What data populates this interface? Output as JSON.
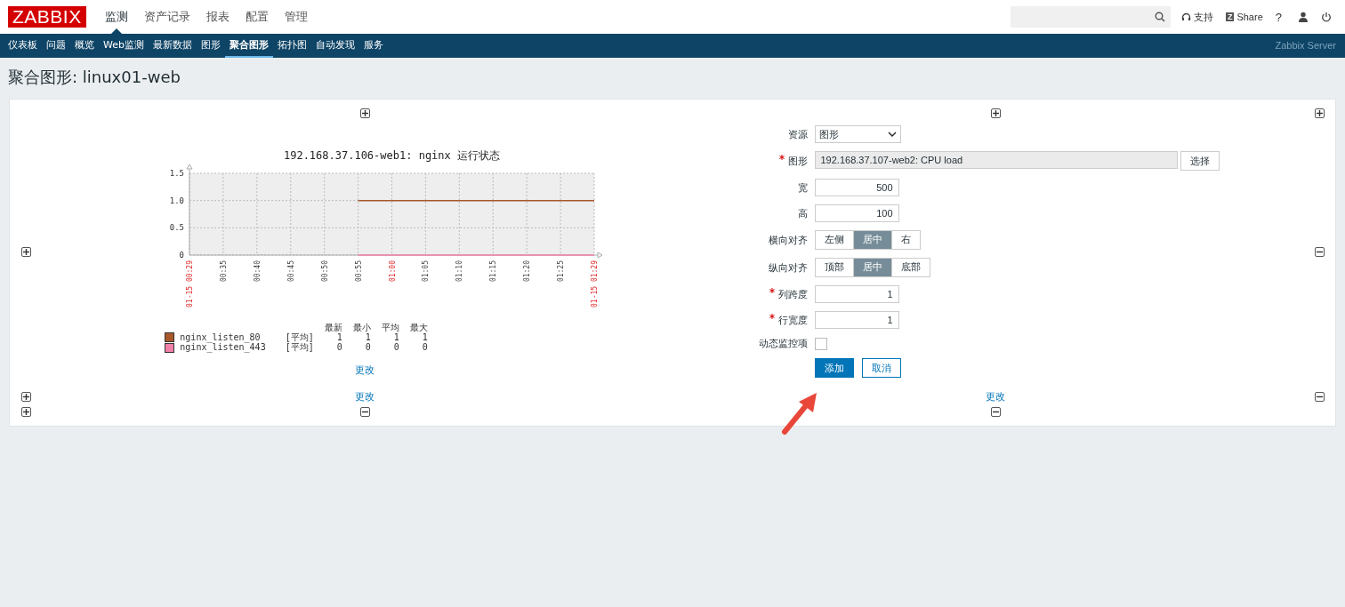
{
  "header": {
    "logo": "ZABBIX",
    "menu": [
      {
        "label": "监测",
        "selected": true
      },
      {
        "label": "资产记录",
        "selected": false
      },
      {
        "label": "报表",
        "selected": false
      },
      {
        "label": "配置",
        "selected": false
      },
      {
        "label": "管理",
        "selected": false
      }
    ],
    "support": "支持",
    "share_badge": "Z",
    "share": "Share",
    "help": "?"
  },
  "subnav": {
    "items": [
      {
        "label": "仪表板",
        "selected": false
      },
      {
        "label": "问题",
        "selected": false
      },
      {
        "label": "概览",
        "selected": false
      },
      {
        "label": "Web监测",
        "selected": false
      },
      {
        "label": "最新数据",
        "selected": false
      },
      {
        "label": "图形",
        "selected": false
      },
      {
        "label": "聚合图形",
        "selected": true
      },
      {
        "label": "拓扑图",
        "selected": false
      },
      {
        "label": "自动发现",
        "selected": false
      },
      {
        "label": "服务",
        "selected": false
      }
    ],
    "server": "Zabbix Server"
  },
  "page_title": "聚合图形: linux01-web",
  "graph": {
    "chart_data": {
      "type": "line",
      "title": "192.168.37.106-web1: nginx 运行状态",
      "categories": [
        "01-15 00:29",
        "00:35",
        "00:40",
        "00:45",
        "00:50",
        "00:55",
        "01:00",
        "01:05",
        "01:10",
        "01:15",
        "01:20",
        "01:25",
        "01-15 01:29"
      ],
      "series": [
        {
          "name": "nginx_listen_80",
          "color": "#a8582a",
          "values": [
            null,
            null,
            null,
            null,
            null,
            1,
            1,
            1,
            1,
            1,
            1,
            1,
            1
          ]
        },
        {
          "name": "nginx_listen_443",
          "color": "#f080a8",
          "values": [
            null,
            null,
            null,
            null,
            null,
            0,
            0,
            0,
            0,
            0,
            0,
            0,
            0
          ]
        }
      ],
      "ylim": [
        0,
        1.5
      ],
      "grid": true,
      "yticks": [
        {
          "value": 0,
          "label": "0"
        },
        {
          "value": 0.5,
          "label": "0.5"
        },
        {
          "value": 1,
          "label": "1.0"
        },
        {
          "value": 1.5,
          "label": "1.5"
        }
      ]
    },
    "x_label_highlighted": [
      true,
      false,
      false,
      false,
      false,
      false,
      true,
      false,
      false,
      false,
      false,
      false,
      true
    ],
    "legend": {
      "columns": [
        "最新",
        "最小",
        "平均",
        "最大"
      ],
      "rows": [
        {
          "func": "[平均]",
          "values": [
            "1",
            "1",
            "1",
            "1"
          ]
        },
        {
          "func": "[平均]",
          "values": [
            "0",
            "0",
            "0",
            "0"
          ]
        }
      ]
    },
    "change_link": "更改"
  },
  "form": {
    "fields": [
      {
        "kind": "select",
        "label": "资源",
        "required": false,
        "value": "图形"
      },
      {
        "kind": "picker",
        "label": "图形",
        "required": true,
        "value": "192.168.37.107-web2: CPU load",
        "button": "选择"
      },
      {
        "kind": "number",
        "label": "宽",
        "required": false,
        "value": "500"
      },
      {
        "kind": "number",
        "label": "高",
        "required": false,
        "value": "100"
      },
      {
        "kind": "segmented",
        "label": "横向对齐",
        "required": false,
        "options": [
          {
            "label": "左侧",
            "selected": false
          },
          {
            "label": "居中",
            "selected": true
          },
          {
            "label": "右",
            "selected": false
          }
        ]
      },
      {
        "kind": "segmented",
        "label": "纵向对齐",
        "required": false,
        "options": [
          {
            "label": "顶部",
            "selected": false
          },
          {
            "label": "居中",
            "selected": true
          },
          {
            "label": "底部",
            "selected": false
          }
        ]
      },
      {
        "kind": "number",
        "label": "列跨度",
        "required": true,
        "value": "1"
      },
      {
        "kind": "number",
        "label": "行宽度",
        "required": true,
        "value": "1"
      },
      {
        "kind": "checkbox",
        "label": "动态监控项",
        "required": false,
        "checked": false
      }
    ],
    "buttons": [
      {
        "label": "添加",
        "kind": "primary"
      },
      {
        "label": "取消",
        "kind": "secondary"
      }
    ]
  },
  "bottom_links": [
    "更改",
    "更改"
  ]
}
